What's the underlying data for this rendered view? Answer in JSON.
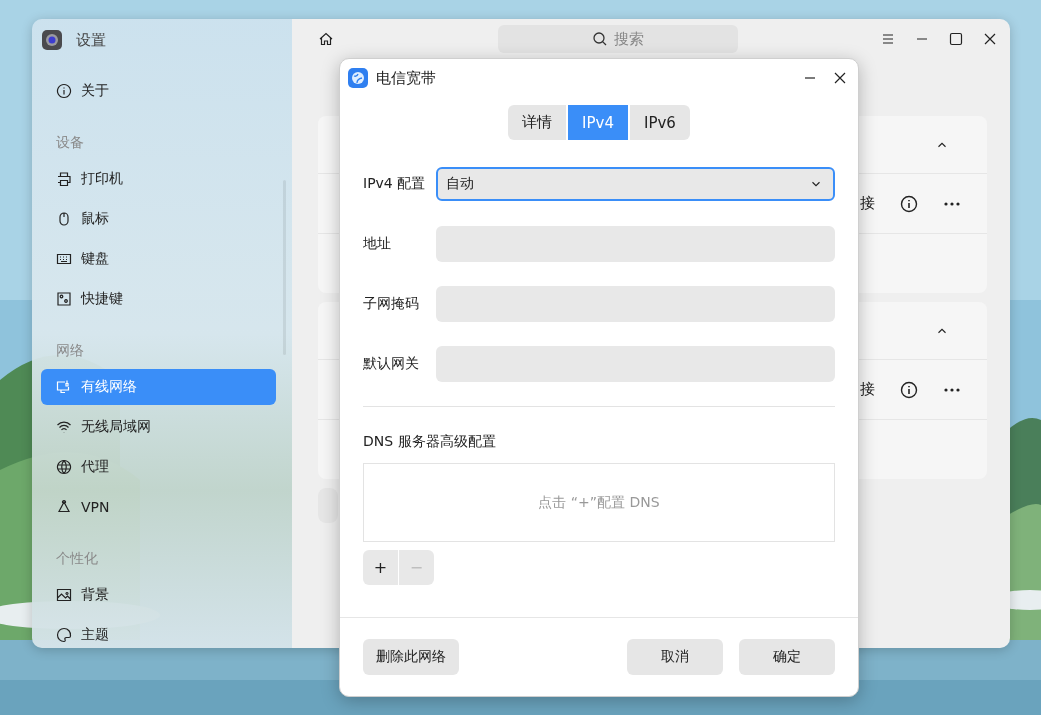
{
  "settings_window": {
    "title": "设置",
    "search": {
      "placeholder": "搜索"
    },
    "sidebar": {
      "items": [
        {
          "kind": "item",
          "label": "关于",
          "selected": false
        },
        {
          "kind": "section",
          "label": "设备"
        },
        {
          "kind": "item",
          "label": "打印机",
          "selected": false
        },
        {
          "kind": "item",
          "label": "鼠标",
          "selected": false
        },
        {
          "kind": "item",
          "label": "键盘",
          "selected": false
        },
        {
          "kind": "item",
          "label": "快捷键",
          "selected": false
        },
        {
          "kind": "section",
          "label": "网络"
        },
        {
          "kind": "item",
          "label": "有线网络",
          "selected": true
        },
        {
          "kind": "item",
          "label": "无线局域网",
          "selected": false
        },
        {
          "kind": "item",
          "label": "代理",
          "selected": false
        },
        {
          "kind": "item",
          "label": "VPN",
          "selected": false
        },
        {
          "kind": "section",
          "label": "个性化"
        },
        {
          "kind": "item",
          "label": "背景",
          "selected": false
        },
        {
          "kind": "item",
          "label": "主题",
          "selected": false
        }
      ]
    },
    "network_cards": [
      {
        "status": "接"
      },
      {
        "status": "接"
      }
    ]
  },
  "dialog": {
    "title": "电信宽带",
    "tabs": [
      {
        "label": "详情",
        "selected": false
      },
      {
        "label": "IPv4",
        "selected": true
      },
      {
        "label": "IPv6",
        "selected": false
      }
    ],
    "fields": [
      {
        "label": "IPv4 配置",
        "kind": "select",
        "value": "自动",
        "focused": true
      },
      {
        "label": "地址",
        "kind": "text",
        "focused": false
      },
      {
        "label": "子网掩码",
        "kind": "text",
        "focused": false
      },
      {
        "label": "默认网关",
        "kind": "text",
        "focused": false
      }
    ],
    "dns": {
      "title": "DNS 服务器高级配置",
      "hint": "点击 “+”配置 DNS",
      "add": "+",
      "remove": "−",
      "remove_disabled": true
    },
    "buttons": {
      "delete": "删除此网络",
      "cancel": "取消",
      "confirm": "确定"
    }
  }
}
